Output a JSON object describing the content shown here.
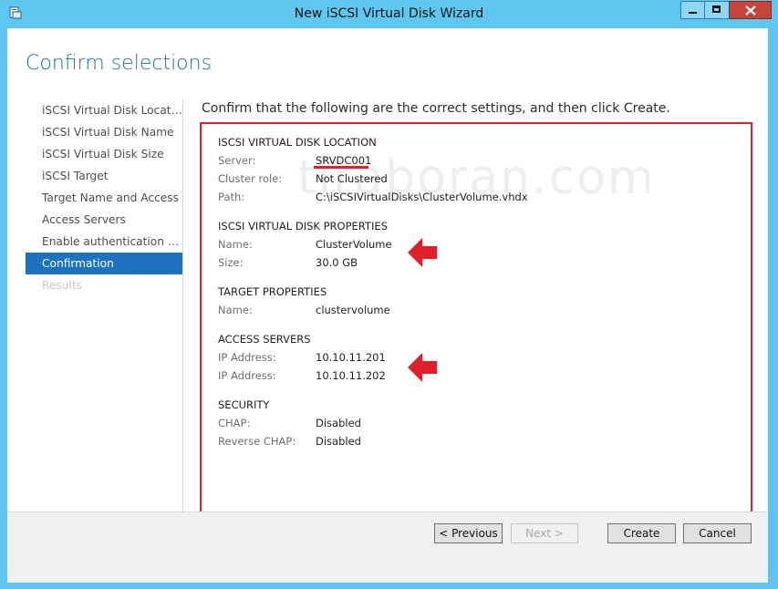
{
  "window": {
    "title": "New iSCSI Virtual Disk Wizard",
    "icon": "wizard-app-icon"
  },
  "page": {
    "heading": "Confirm selections",
    "instruction": "Confirm that the following are the correct settings, and then click Create.",
    "watermark": "tiraboran.com"
  },
  "nav": {
    "items": [
      {
        "label": "iSCSI Virtual Disk Location",
        "state": "normal"
      },
      {
        "label": "iSCSI Virtual Disk Name",
        "state": "normal"
      },
      {
        "label": "iSCSI Virtual Disk Size",
        "state": "normal"
      },
      {
        "label": "iSCSI Target",
        "state": "normal"
      },
      {
        "label": "Target Name and Access",
        "state": "normal"
      },
      {
        "label": "Access Servers",
        "state": "normal"
      },
      {
        "label": "Enable authentication ser...",
        "state": "normal"
      },
      {
        "label": "Confirmation",
        "state": "active"
      },
      {
        "label": "Results",
        "state": "disabled"
      }
    ]
  },
  "sections": {
    "location": {
      "title": "ISCSI VIRTUAL DISK LOCATION",
      "rows": [
        {
          "label": "Server:",
          "value": "SRVDC001"
        },
        {
          "label": "Cluster role:",
          "value": "Not Clustered"
        },
        {
          "label": "Path:",
          "value": "C:\\iSCSIVirtualDisks\\ClusterVolume.vhdx"
        }
      ]
    },
    "properties": {
      "title": "ISCSI VIRTUAL DISK PROPERTIES",
      "rows": [
        {
          "label": "Name:",
          "value": "ClusterVolume"
        },
        {
          "label": "Size:",
          "value": "30.0 GB"
        }
      ]
    },
    "target": {
      "title": "TARGET PROPERTIES",
      "rows": [
        {
          "label": "Name:",
          "value": "clustervolume"
        }
      ]
    },
    "access": {
      "title": "ACCESS SERVERS",
      "rows": [
        {
          "label": "IP Address:",
          "value": "10.10.11.201"
        },
        {
          "label": "IP Address:",
          "value": "10.10.11.202"
        }
      ]
    },
    "security": {
      "title": "SECURITY",
      "rows": [
        {
          "label": "CHAP:",
          "value": "Disabled"
        },
        {
          "label": "Reverse CHAP:",
          "value": "Disabled"
        }
      ]
    }
  },
  "buttons": {
    "previous": "< Previous",
    "next": "Next >",
    "create": "Create",
    "cancel": "Cancel"
  },
  "colors": {
    "accent": "#1e72be",
    "titlebar": "#5ec7f0",
    "annotation": "#e0202a"
  }
}
